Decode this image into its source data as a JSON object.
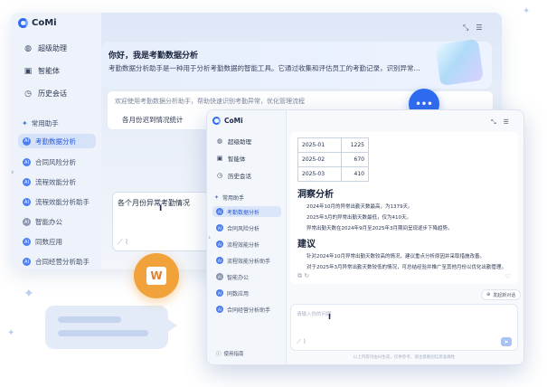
{
  "brand": {
    "name": "CoMi"
  },
  "back_window": {
    "nav": [
      {
        "icon": "chat-icon",
        "label": "超级助理"
      },
      {
        "icon": "robot-icon",
        "label": "智能体"
      },
      {
        "icon": "history-icon",
        "label": "历史会话"
      }
    ],
    "section_title": "常用助手",
    "assistants": [
      {
        "label": "考勤数据分析",
        "active": true
      },
      {
        "label": "合同风险分析",
        "active": false
      },
      {
        "label": "流程效能分析",
        "active": false
      },
      {
        "label": "流程效能分析助手",
        "active": false
      },
      {
        "label": "智能办公",
        "active": false
      },
      {
        "label": "同数应用",
        "active": false
      },
      {
        "label": "合同经营分析助手",
        "active": false
      }
    ],
    "hero": {
      "title": "你好，我是考勤数据分析",
      "desc": "考勤数据分析助手是一种用于分析考勤数据的智能工具。它通过收集和评估员工的考勤记录，识别异常..."
    },
    "welcome": {
      "text": "欢迎使用考勤数据分析助手，帮助快速识别考勤异常，优化管理流程",
      "suggestion": "各月份迟到情况统计"
    },
    "input_value": "各个月份异常考勤情况"
  },
  "front_window": {
    "nav": [
      {
        "icon": "chat-icon",
        "label": "超级助理"
      },
      {
        "icon": "robot-icon",
        "label": "智能体"
      },
      {
        "icon": "history-icon",
        "label": "历史会话"
      }
    ],
    "section_title": "常用助手",
    "assistants": [
      {
        "label": "考勤数据分析",
        "active": true
      },
      {
        "label": "合同风险分析",
        "active": false
      },
      {
        "label": "流程效能分析",
        "active": false
      },
      {
        "label": "流程效能分析助手",
        "active": false
      },
      {
        "label": "智能办公",
        "active": false
      },
      {
        "label": "同数应用",
        "active": false
      },
      {
        "label": "合同经营分析助手",
        "active": false
      }
    ],
    "help_label": "使用指南",
    "table": [
      {
        "month": "2025-01",
        "value": "1225"
      },
      {
        "month": "2025-02",
        "value": "670"
      },
      {
        "month": "2025-03",
        "value": "410"
      }
    ],
    "insight_title": "洞察分析",
    "insights": [
      "2024年10月的异常出勤天数最高，为1379天。",
      "2025年3月的异常出勤天数最低，仅为410天。",
      "异常出勤天数在2024年9月至2025年3月期间呈现逐步下降趋势。"
    ],
    "advice_title": "建议",
    "advices": [
      "针对2024年10月异常出勤天数较高的情况，建议重点分析原因并采取措施改善。",
      "对于2025年3月异常出勤天数较低的情况，可总结经验并推广至其他月份以优化出勤管理。"
    ],
    "new_chat_label": "发起新对话",
    "input_placeholder": "请输入你的问题",
    "disclaimer": "以上内容均由AI生成，仅供参考，请注意甄别信息准确性"
  },
  "colors": {
    "accent": "#2f6bf0",
    "word_badge": "#f1a23a"
  }
}
